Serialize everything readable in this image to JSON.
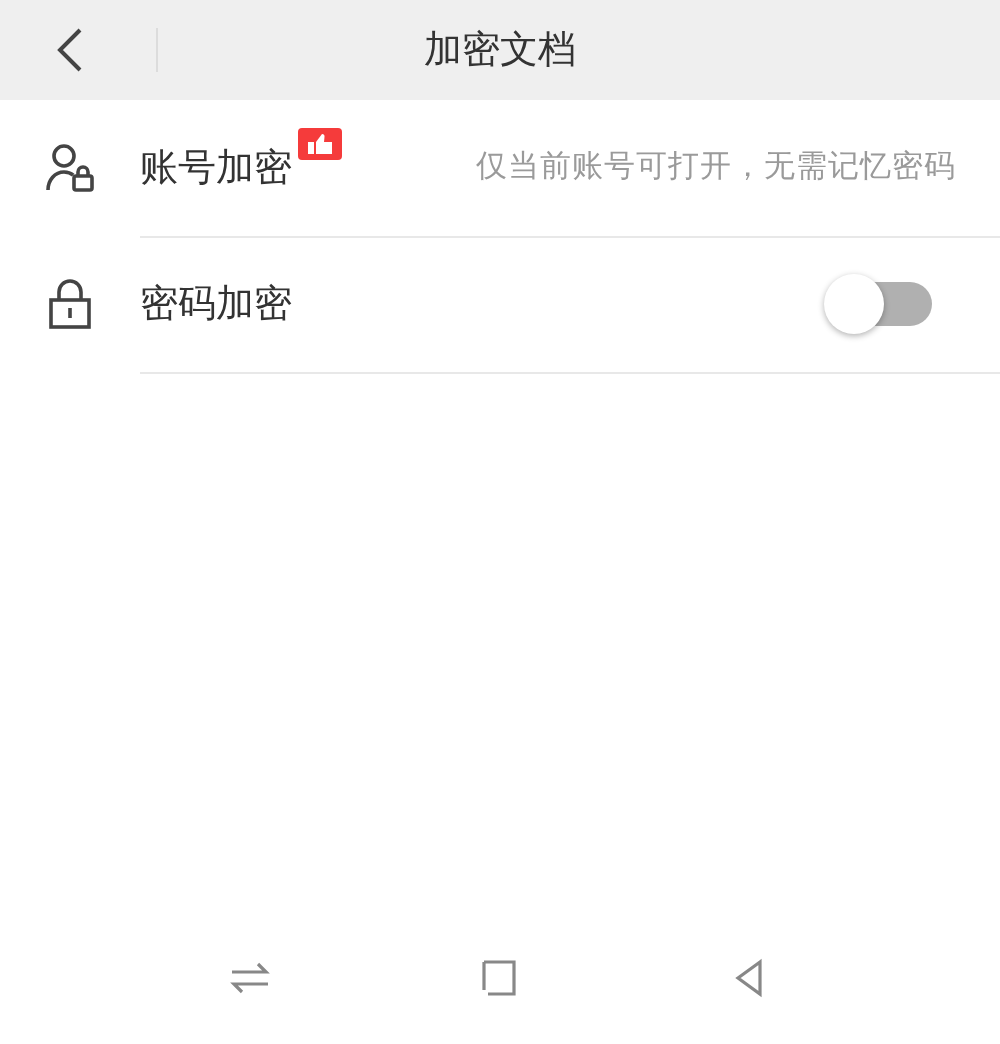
{
  "header": {
    "title": "加密文档"
  },
  "options": [
    {
      "kind": "badge",
      "label": "账号加密",
      "hint": "仅当前账号可打开，无需记忆密码"
    },
    {
      "kind": "toggle",
      "label": "密码加密",
      "on": false
    }
  ]
}
